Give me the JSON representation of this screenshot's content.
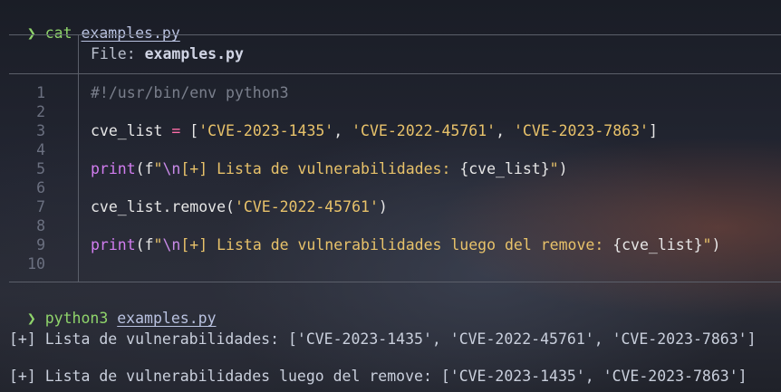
{
  "terminal": {
    "prompt_symbol": "❯",
    "commands": [
      {
        "cmd": "cat",
        "arg": "examples.py"
      },
      {
        "cmd": "python3",
        "arg": "examples.py"
      }
    ]
  },
  "file_view": {
    "label": "File:",
    "filename": "examples.py",
    "line_numbers": [
      "1",
      "2",
      "3",
      "4",
      "5",
      "6",
      "7",
      "8",
      "9",
      "10"
    ],
    "lines": {
      "l1": "#!/usr/bin/env python3",
      "l3": {
        "var": "cve_list",
        "op": "=",
        "open": "[",
        "s1": "'CVE-2023-1435'",
        "sep1": ", ",
        "s2": "'CVE-2022-45761'",
        "sep2": ", ",
        "s3": "'CVE-2023-7863'",
        "close": "]"
      },
      "l5": {
        "fn": "print",
        "open": "(",
        "fprefix": "f",
        "q": "\"",
        "esc": "\\n",
        "text": "[+] Lista de vulnerabilidades: ",
        "expr": "{cve_list}",
        "qend": "\"",
        "close": ")"
      },
      "l7": {
        "call": "cve_list.remove(",
        "arg": "'CVE-2022-45761'",
        "close": ")"
      },
      "l9": {
        "fn": "print",
        "open": "(",
        "fprefix": "f",
        "q": "\"",
        "esc": "\\n",
        "text": "[+] Lista de vulnerabilidades luego del remove: ",
        "expr": "{cve_list}",
        "qend": "\"",
        "close": ")"
      }
    }
  },
  "output": [
    "[+] Lista de vulnerabilidades: ['CVE-2023-1435', 'CVE-2022-45761', 'CVE-2023-7863']",
    "[+] Lista de vulnerabilidades luego del remove: ['CVE-2023-1435', 'CVE-2023-7863']"
  ],
  "colors": {
    "prompt": "#8fd46b",
    "string": "#e8c26a",
    "operator": "#ff6ea8",
    "keyword": "#d27df0"
  }
}
